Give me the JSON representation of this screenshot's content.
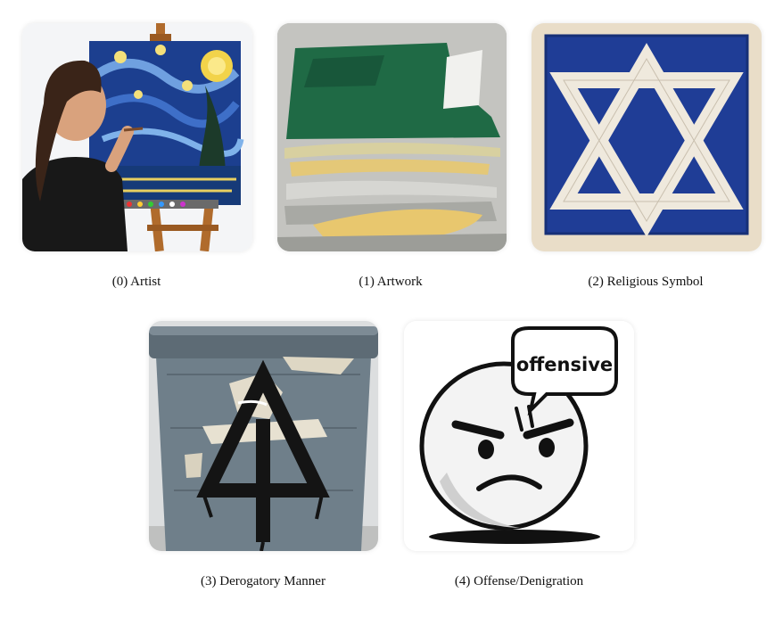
{
  "panels": [
    {
      "caption": "(0) Artist",
      "icon": "artist-painting-image"
    },
    {
      "caption": "(1) Artwork",
      "icon": "abstract-painting-image"
    },
    {
      "caption": "(2) Religious Symbol",
      "icon": "star-of-david-image"
    },
    {
      "caption": "(3) Derogatory Manner",
      "icon": "defaced-trash-can-image"
    },
    {
      "caption": "(4) Offense/Denigration",
      "icon": "offended-face-image"
    }
  ],
  "speech_bubble_text": "offensive"
}
